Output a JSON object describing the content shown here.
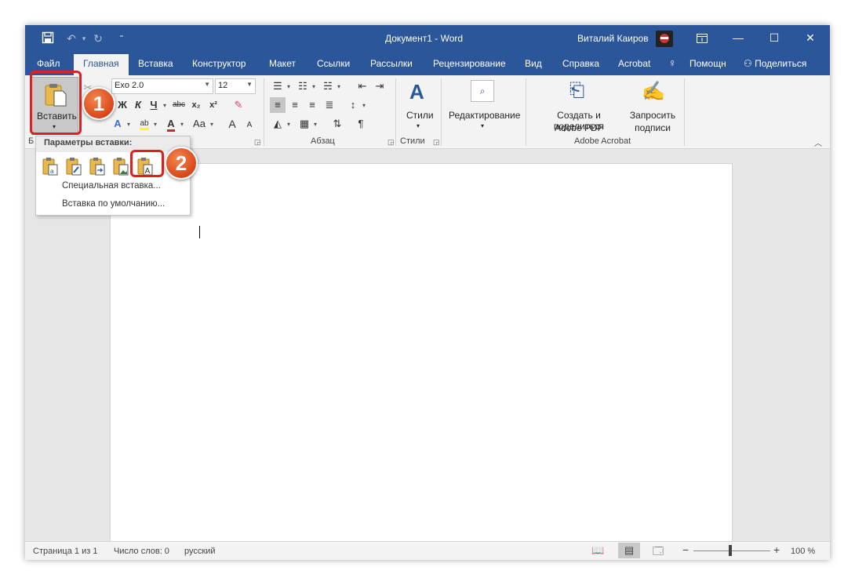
{
  "title_bar": {
    "document_title": "Документ1",
    "separator": "-",
    "app_name": "Word",
    "user_name": "Виталий Каиров"
  },
  "tabs": [
    "Файл",
    "Главная",
    "Вставка",
    "Конструктор",
    "Макет",
    "Ссылки",
    "Рассылки",
    "Рецензирование",
    "Вид",
    "Справка",
    "Acrobat"
  ],
  "tell_me": "Помощн",
  "share": "Поделиться",
  "ribbon": {
    "paste_label": "Вставить",
    "clipboard_group": "Б",
    "font_group_tail": "т",
    "font_name": "Exo 2.0",
    "font_size": "12",
    "paragraph_group": "Абзац",
    "styles_label": "Стили",
    "styles_group": "Стили",
    "editing_label": "Редактирование",
    "adobe_create_line1": "Создать и поделиться",
    "adobe_create_line2": "Adobe PDF",
    "adobe_sign_line1": "Запросить",
    "adobe_sign_line2": "подписи",
    "adobe_group": "Adobe Acrobat",
    "bold": "Ж",
    "italic": "К",
    "underline": "Ч",
    "strike": "abc",
    "subscript": "x₂",
    "superscript": "x²",
    "grow_font": "A",
    "shrink_font": "A",
    "change_case": "Aa"
  },
  "paste_menu": {
    "header": "Параметры вставки:",
    "special": "Специальная вставка...",
    "default": "Вставка по умолчанию..."
  },
  "callouts": [
    "1",
    "2"
  ],
  "status": {
    "page": "Страница 1 из 1",
    "words": "Число слов: 0",
    "language": "русский",
    "zoom": "100 %",
    "zoom_minus": "−",
    "zoom_plus": "+"
  },
  "colors": {
    "accent": "#2b579a",
    "highlight": "#e02020",
    "callout": "#d9471a"
  }
}
